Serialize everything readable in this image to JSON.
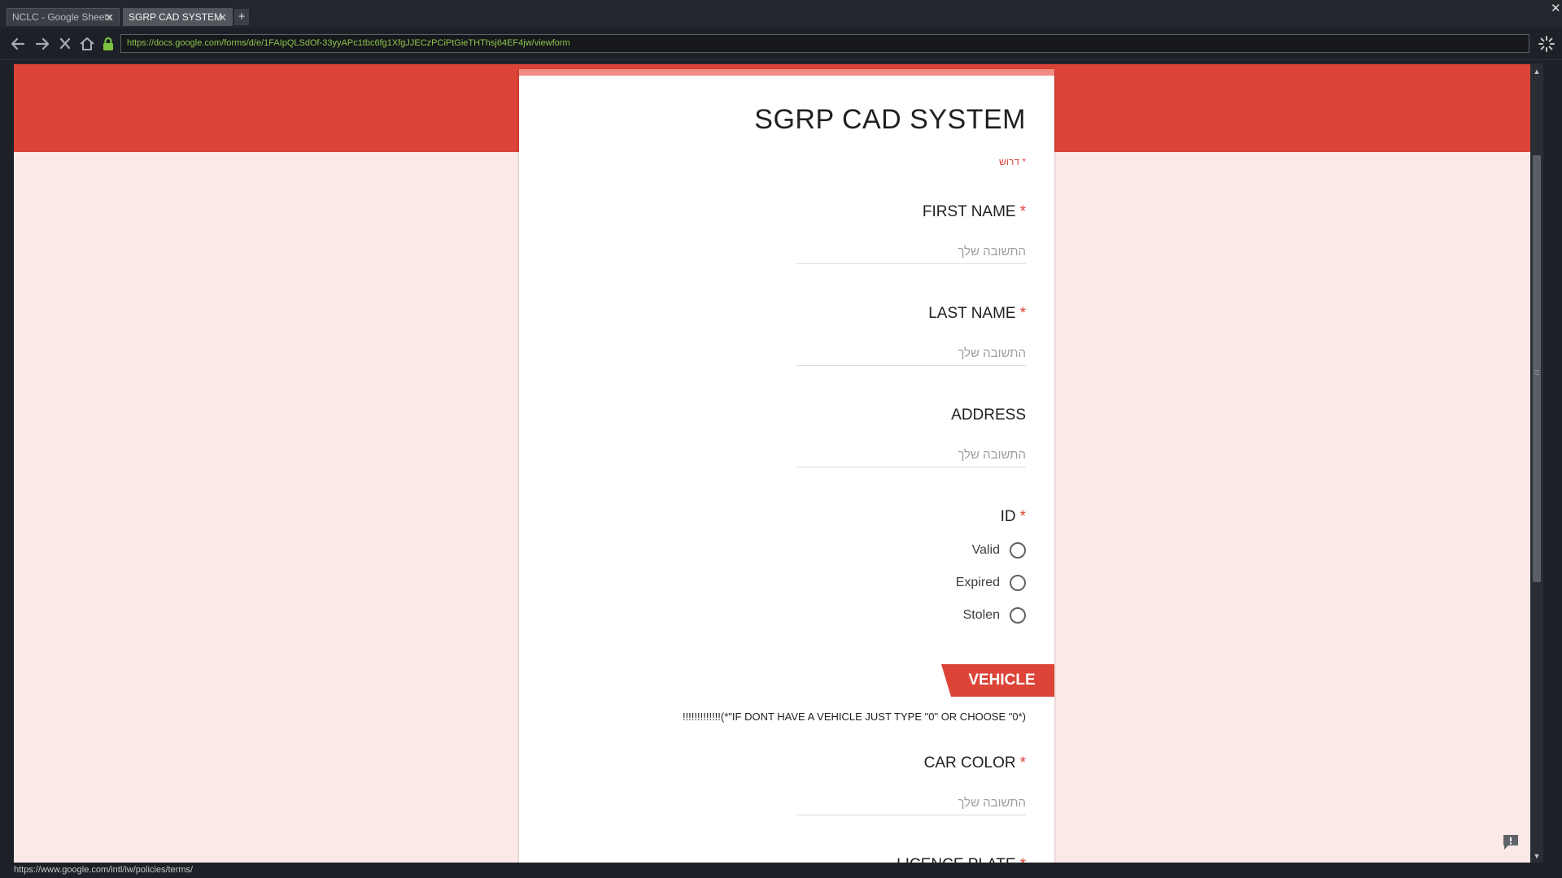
{
  "browser": {
    "tabs": [
      {
        "title": "NCLC - Google Sheets",
        "active": false
      },
      {
        "title": "SGRP CAD SYSTEM",
        "active": true
      }
    ],
    "new_tab_label": "+",
    "url": "https://docs.google.com/forms/d/e/1FAIpQLSdOf-33yyAPc1tbc6fg1XfgJJECzPCiPtGieTHThsj64EF4jw/viewform",
    "status_url": "https://www.google.com/intl/iw/policies/terms/",
    "icons": [
      "back-arrow-icon",
      "forward-arrow-icon",
      "stop-icon",
      "home-icon",
      "lock-icon",
      "loading-spinner-icon",
      "close-icon"
    ]
  },
  "form": {
    "title": "SGRP CAD SYSTEM",
    "required_note": "* דרוש",
    "answer_placeholder": "התשובה שלך",
    "required_marker": "*",
    "questions": {
      "first_name": {
        "label": "FIRST NAME",
        "required": true
      },
      "last_name": {
        "label": "LAST NAME",
        "required": true
      },
      "address": {
        "label": "ADDRESS",
        "required": false
      },
      "id": {
        "label": "ID",
        "required": true,
        "options": [
          "Valid",
          "Expired",
          "Stolen"
        ]
      },
      "car_color": {
        "label": "CAR COLOR",
        "required": true
      },
      "licence_plate": {
        "label": "LICENCE PLATE",
        "required": true
      }
    },
    "section": {
      "title": "VEHICLE",
      "description": "!!!!!!!!!!!!!(*\"IF DONT HAVE A VEHICLE JUST TYPE \"0\" OR CHOOSE \"0*)"
    }
  },
  "colors": {
    "accent": "#db4437",
    "page_background": "#fbe9e7",
    "card_top_bar": "#f28b82",
    "url_text": "#8dc44a"
  }
}
